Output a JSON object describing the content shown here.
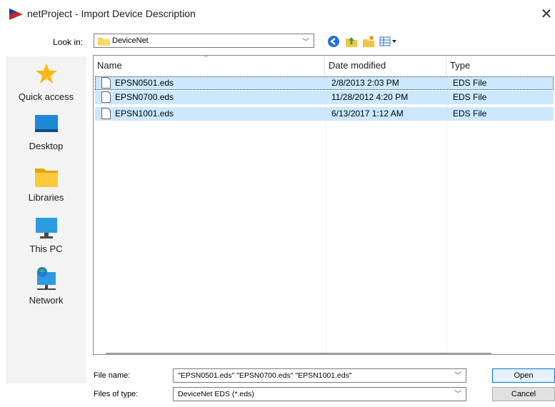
{
  "window": {
    "title": "netProject - Import Device Description",
    "close_glyph": "✕"
  },
  "toolbar": {
    "look_in_label": "Look in:",
    "look_in_value": "DeviceNet",
    "icons": [
      "back-icon",
      "up-folder-icon",
      "new-folder-icon",
      "view-menu-icon"
    ]
  },
  "places": [
    {
      "label": "Quick access",
      "icon": "star-icon"
    },
    {
      "label": "Desktop",
      "icon": "desktop-icon"
    },
    {
      "label": "Libraries",
      "icon": "libraries-folder-icon"
    },
    {
      "label": "This PC",
      "icon": "computer-icon"
    },
    {
      "label": "Network",
      "icon": "network-icon"
    }
  ],
  "file_list": {
    "columns": [
      "Name",
      "Date modified",
      "Type"
    ],
    "rows": [
      {
        "name": "EPSN0501.eds",
        "date": "2/8/2013 2:03 PM",
        "type": "EDS File"
      },
      {
        "name": "EPSN0700.eds",
        "date": "11/28/2012 4:20 PM",
        "type": "EDS File"
      },
      {
        "name": "EPSN1001.eds",
        "date": "6/13/2017 1:12 AM",
        "type": "EDS File"
      }
    ]
  },
  "bottom": {
    "file_name_label": "File name:",
    "file_name_value": "\"EPSN0501.eds\" \"EPSN0700.eds\" \"EPSN1001.eds\"",
    "file_type_label": "Files of type:",
    "file_type_value": "DeviceNet EDS (*.eds)",
    "open_label": "Open",
    "cancel_label": "Cancel"
  },
  "colors": {
    "selection": "#cce8ff",
    "accent": "#0078d7"
  }
}
